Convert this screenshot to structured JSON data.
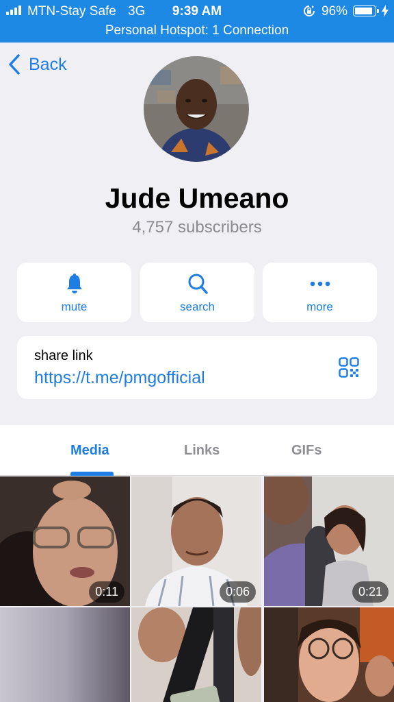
{
  "status_bar": {
    "carrier": "MTN-Stay Safe",
    "network": "3G",
    "time": "9:39 AM",
    "battery": "96%",
    "icons": [
      "signal-icon",
      "rotation-lock-icon",
      "battery-icon",
      "charging-bolt-icon"
    ]
  },
  "hotspot": {
    "text": "Personal Hotspot: 1 Connection"
  },
  "header": {
    "back_label": "Back"
  },
  "profile": {
    "name": "Jude Umeano",
    "subscribers": "4,757 subscribers"
  },
  "actions": [
    {
      "label": "mute",
      "icon": "bell-icon"
    },
    {
      "label": "search",
      "icon": "search-icon"
    },
    {
      "label": "more",
      "icon": "more-dots-icon"
    }
  ],
  "share": {
    "title": "share link",
    "url": "https://t.me/pmgofficial",
    "icon": "qr-code-icon"
  },
  "tabs": [
    {
      "label": "Media",
      "active": true
    },
    {
      "label": "Links",
      "active": false
    },
    {
      "label": "GIFs",
      "active": false
    }
  ],
  "media": [
    {
      "duration": "0:11"
    },
    {
      "duration": "0:06"
    },
    {
      "duration": "0:21"
    },
    {
      "duration": ""
    },
    {
      "duration": ""
    },
    {
      "duration": ""
    }
  ],
  "colors": {
    "accent": "#1e7ee3",
    "status_bar": "#1e88e5",
    "background": "#efeff4"
  }
}
